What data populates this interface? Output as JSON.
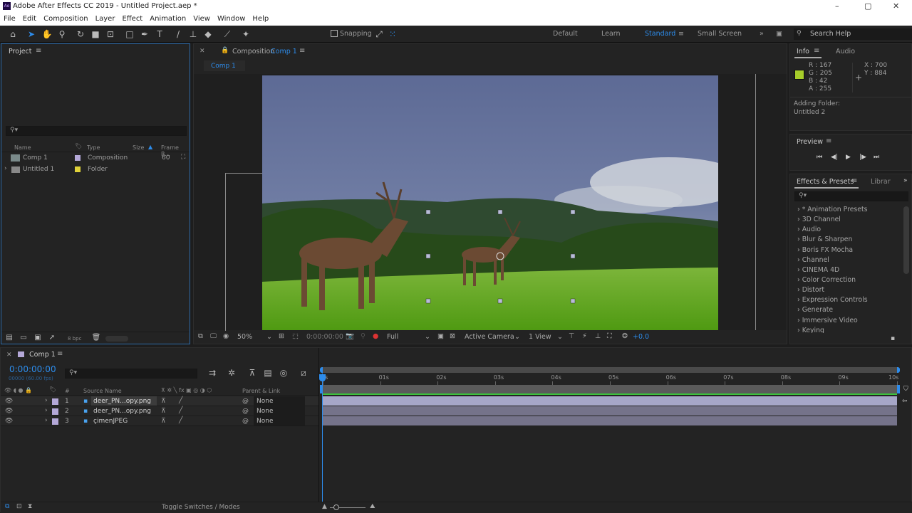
{
  "window": {
    "title": "Adobe After Effects CC 2019 - Untitled Project.aep *",
    "logo": "Ae"
  },
  "menu": [
    "File",
    "Edit",
    "Composition",
    "Layer",
    "Effect",
    "Animation",
    "View",
    "Window",
    "Help"
  ],
  "toolbar": {
    "snapping": "Snapping",
    "workspaces": [
      "Default",
      "Learn",
      "Standard",
      "Small Screen"
    ],
    "active_workspace": "Standard",
    "search_help": "Search Help"
  },
  "project": {
    "title": "Project",
    "search_placeholder": "",
    "columns": [
      "Name",
      "Type",
      "Size",
      "Frame R..."
    ],
    "items": [
      {
        "name": "Comp 1",
        "type": "Composition",
        "frame_rate": "60",
        "label_color": "#b4a8d8"
      },
      {
        "name": "Untitled 1",
        "type": "Folder",
        "frame_rate": "",
        "label_color": "#e0d23a"
      }
    ],
    "bpc": "8 bpc"
  },
  "composition": {
    "panel_title": "Composition",
    "comp_name": "Comp 1",
    "tab": "Comp 1",
    "viewer_bar": {
      "zoom": "50%",
      "timecode": "0:00:00:00",
      "resolution": "Full",
      "camera": "Active Camera",
      "views": "1 View",
      "exposure": "+0.0"
    }
  },
  "info": {
    "tabs": [
      "Info",
      "Audio"
    ],
    "r": "R : 167",
    "g": "G : 205",
    "b": "B : 42",
    "a": "A : 255",
    "x": "X : 700",
    "y": "Y : 884",
    "swatch": "#a7cd2a",
    "status_line1": "Adding Folder:",
    "status_line2": "Untitled 2"
  },
  "preview": {
    "title": "Preview"
  },
  "effects": {
    "tabs": [
      "Effects & Presets",
      "Librar"
    ],
    "items": [
      "* Animation Presets",
      "3D Channel",
      "Audio",
      "Blur & Sharpen",
      "Boris FX Mocha",
      "Channel",
      "CINEMA 4D",
      "Color Correction",
      "Distort",
      "Expression Controls",
      "Generate",
      "Immersive Video",
      "Keying"
    ]
  },
  "timeline": {
    "tab": "Comp 1",
    "timecode": "0:00:00:00",
    "frames": "00000 (60.00 fps)",
    "col_source": "Source Name",
    "col_parent": "Parent & Link",
    "layers": [
      {
        "num": "1",
        "name": "deer_PN...opy.png",
        "parent": "None"
      },
      {
        "num": "2",
        "name": "deer_PN...opy.png",
        "parent": "None"
      },
      {
        "num": "3",
        "name": "çimenJPEG",
        "parent": "None"
      }
    ],
    "ruler": [
      "0s",
      "01s",
      "02s",
      "03s",
      "04s",
      "05s",
      "06s",
      "07s",
      "08s",
      "09s",
      "10s"
    ],
    "toggle": "Toggle Switches / Modes"
  }
}
